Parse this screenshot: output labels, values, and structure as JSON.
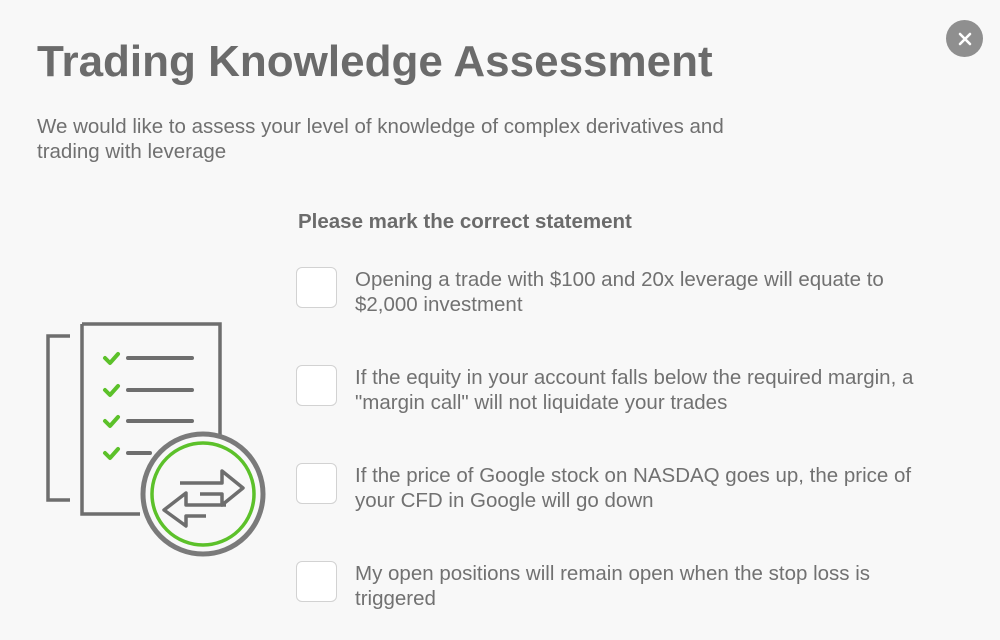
{
  "modal": {
    "title": "Trading Knowledge Assessment",
    "subtitle": "We would like to assess your level of knowledge of complex derivatives and trading with leverage",
    "close_icon": "close-icon",
    "question": "Please mark the correct statement",
    "illustration_icon": "checklist-exchange-icon",
    "options": [
      {
        "label": "Opening a trade with $100 and 20x leverage will equate to $2,000 investment",
        "checked": false
      },
      {
        "label": "If the equity in your account falls below the required margin, a \"margin call\" will not liquidate your trades",
        "checked": false
      },
      {
        "label": "If the price of Google stock on NASDAQ goes up, the price of your CFD in Google will go down",
        "checked": false
      },
      {
        "label": "My open positions will remain open when the stop loss is triggered",
        "checked": false
      }
    ]
  },
  "colors": {
    "text": "#6b6b6b",
    "accent_green": "#5cc12a",
    "close_bg": "#8f8f8f",
    "background": "#f8f8f8"
  }
}
